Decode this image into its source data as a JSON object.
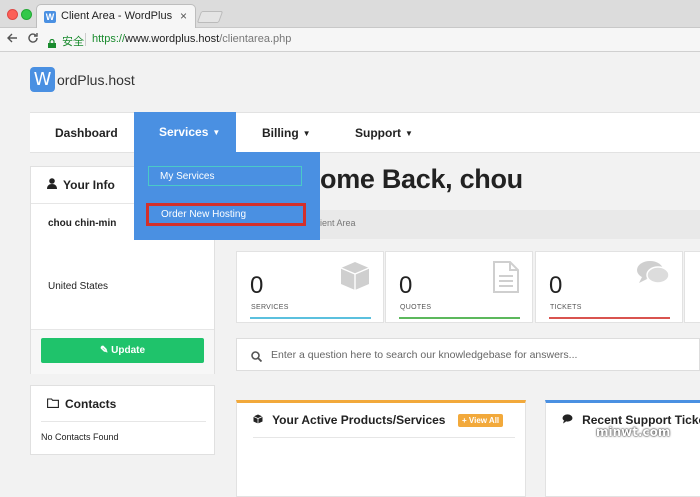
{
  "browser": {
    "tab_title": "Client Area - WordPlus",
    "tab_close": "×",
    "favicon_letter": "W",
    "secure_label": "安全",
    "url_scheme": "https://",
    "url_host": "www.wordplus.host",
    "url_path": "/clientarea.php"
  },
  "logo": {
    "mark": "W",
    "text": "ordPlus.host"
  },
  "navbar": {
    "dashboard": "Dashboard",
    "services": "Services",
    "billing": "Billing",
    "support": "Support"
  },
  "services_dropdown": {
    "items": [
      "My Services",
      "Order New Hosting"
    ]
  },
  "your_info": {
    "title": "Your Info",
    "name": "chou chin-min",
    "country": "United States",
    "update_label": "Update"
  },
  "contacts": {
    "title": "Contacts",
    "empty": "No Contacts Found"
  },
  "main": {
    "welcome": "ome Back, chou",
    "breadcrumb": "ient Area"
  },
  "stats": [
    {
      "value": "0",
      "label": "SERVICES",
      "color": "#5bc0de",
      "icon": "cube-icon"
    },
    {
      "value": "0",
      "label": "QUOTES",
      "color": "#5cb85c",
      "icon": "document-icon"
    },
    {
      "value": "0",
      "label": "TICKETS",
      "color": "#d9534f",
      "icon": "comments-icon"
    }
  ],
  "search": {
    "placeholder": "Enter a question here to search our knowledgebase for answers..."
  },
  "products_box": {
    "title": "Your Active Products/Services",
    "view_all": "View All"
  },
  "tickets_box": {
    "title": "Recent Support Tickets"
  },
  "watermark": "minwt.com",
  "colors": {
    "accent": "#4a90e2",
    "update": "#1fc36b",
    "highlight": "#d3302a"
  }
}
